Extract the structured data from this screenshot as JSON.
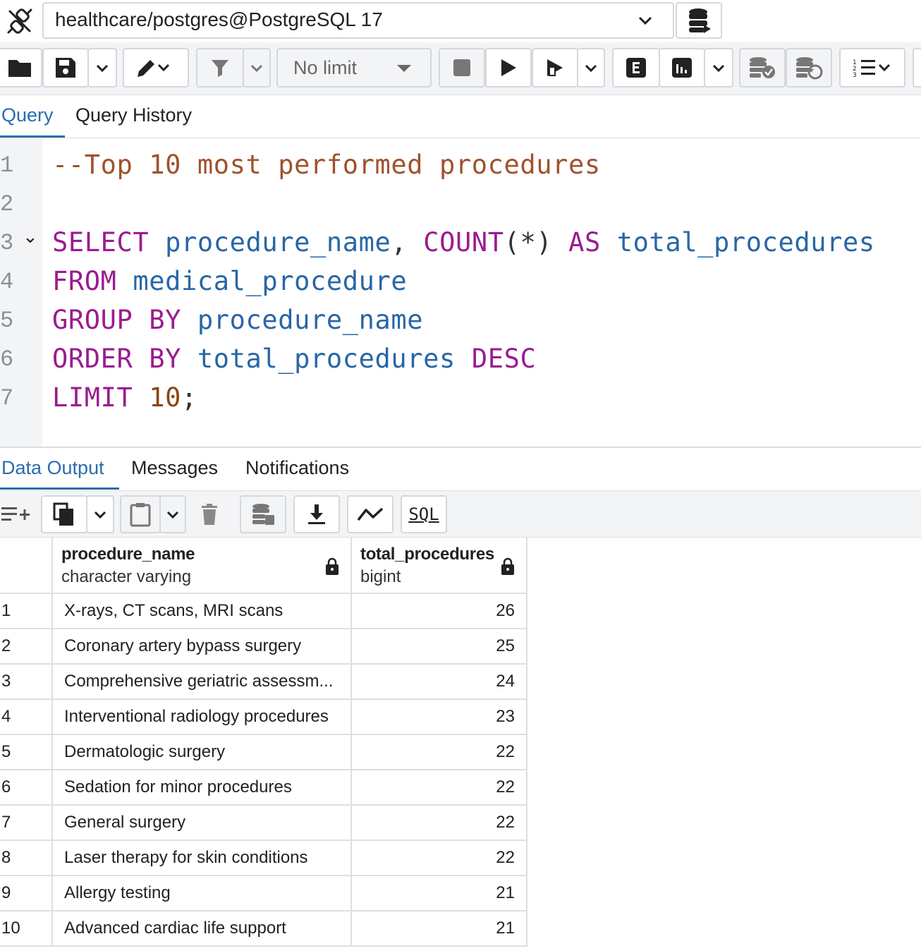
{
  "connection": {
    "label": "healthcare/postgres@PostgreSQL 17"
  },
  "toolbar": {
    "limit_label": "No limit"
  },
  "editor_tabs": [
    "Query",
    "Query History"
  ],
  "editor": {
    "line_numbers": [
      "1",
      "2",
      "3",
      "4",
      "5",
      "6",
      "7"
    ],
    "fold_marker": "⌄",
    "line1": {
      "comment": "--Top 10 most performed procedures"
    },
    "line3": {
      "k1": "SELECT",
      "i1": "procedure_name",
      "p1": ",",
      "k2": "COUNT",
      "p2": "(*)",
      "k3": "AS",
      "i2": "total_procedures"
    },
    "line4": {
      "k1": "FROM",
      "i1": "medical_procedure"
    },
    "line5": {
      "k1": "GROUP BY",
      "i1": "procedure_name"
    },
    "line6": {
      "k1": "ORDER BY",
      "i1": "total_procedures",
      "k2": "DESC"
    },
    "line7": {
      "k1": "LIMIT",
      "n1": "10",
      "p1": ";"
    }
  },
  "output_tabs": [
    "Data Output",
    "Messages",
    "Notifications"
  ],
  "output_toolbar": {
    "sql_label": "SQL"
  },
  "results": {
    "columns": [
      {
        "name": "procedure_name",
        "type": "character varying"
      },
      {
        "name": "total_procedures",
        "type": "bigint"
      }
    ],
    "rows": [
      {
        "num": "1",
        "procedure_name": "X-rays, CT scans, MRI scans",
        "total": "26"
      },
      {
        "num": "2",
        "procedure_name": "Coronary artery bypass surgery",
        "total": "25"
      },
      {
        "num": "3",
        "procedure_name": "Comprehensive geriatric assessm...",
        "total": "24"
      },
      {
        "num": "4",
        "procedure_name": "Interventional radiology procedures",
        "total": "23"
      },
      {
        "num": "5",
        "procedure_name": "Dermatologic surgery",
        "total": "22"
      },
      {
        "num": "6",
        "procedure_name": "Sedation for minor procedures",
        "total": "22"
      },
      {
        "num": "7",
        "procedure_name": "General surgery",
        "total": "22"
      },
      {
        "num": "8",
        "procedure_name": "Laser therapy for skin conditions",
        "total": "22"
      },
      {
        "num": "9",
        "procedure_name": "Allergy testing",
        "total": "21"
      },
      {
        "num": "10",
        "procedure_name": "Advanced cardiac life support",
        "total": "21"
      }
    ]
  }
}
